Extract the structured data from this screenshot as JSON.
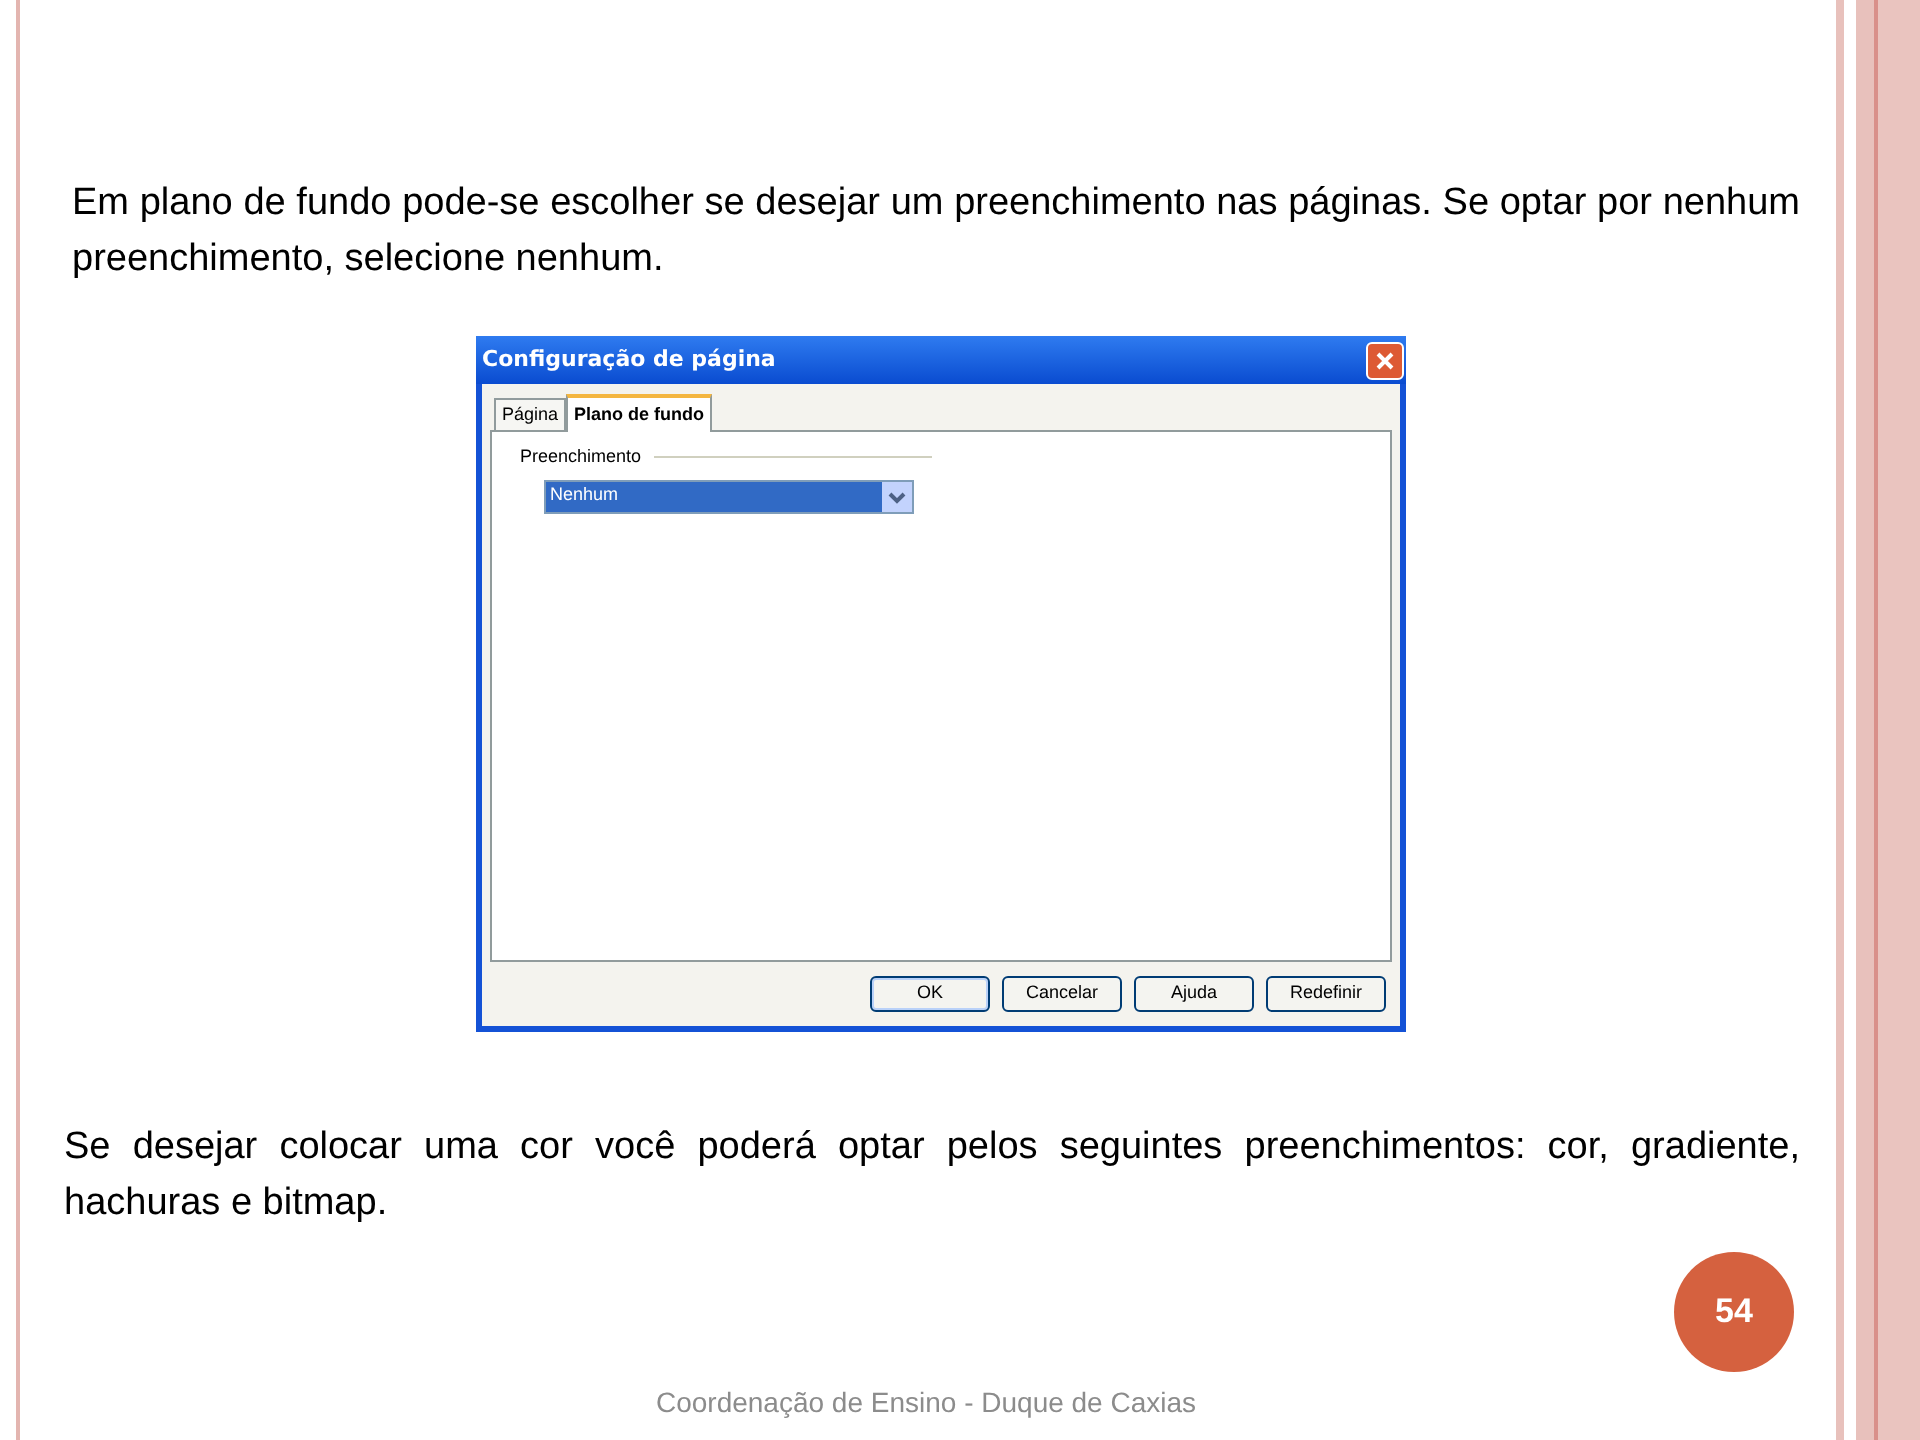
{
  "paragraphs": [
    "Em plano de fundo pode-se escolher se desejar um preenchimento nas páginas. Se optar por nenhum preenchimento, selecione nenhum.",
    "Se desejar colocar uma cor você poderá optar pelos seguintes preenchimentos: cor, gradiente, hachuras e bitmap."
  ],
  "dialog": {
    "title": "Configuração de página",
    "tabs": [
      {
        "label": "Página",
        "selected": false
      },
      {
        "label": "Plano de fundo",
        "selected": true
      }
    ],
    "group_label": "Preenchimento",
    "fill_select": {
      "value": "Nenhum"
    },
    "buttons": [
      {
        "label": "OK",
        "default": true
      },
      {
        "label": "Cancelar",
        "default": false
      },
      {
        "label": "Ajuda",
        "default": false
      },
      {
        "label": "Redefinir",
        "default": false
      }
    ]
  },
  "page_number": "54",
  "footer": "Coordenação de Ensino - Duque de Caxias"
}
